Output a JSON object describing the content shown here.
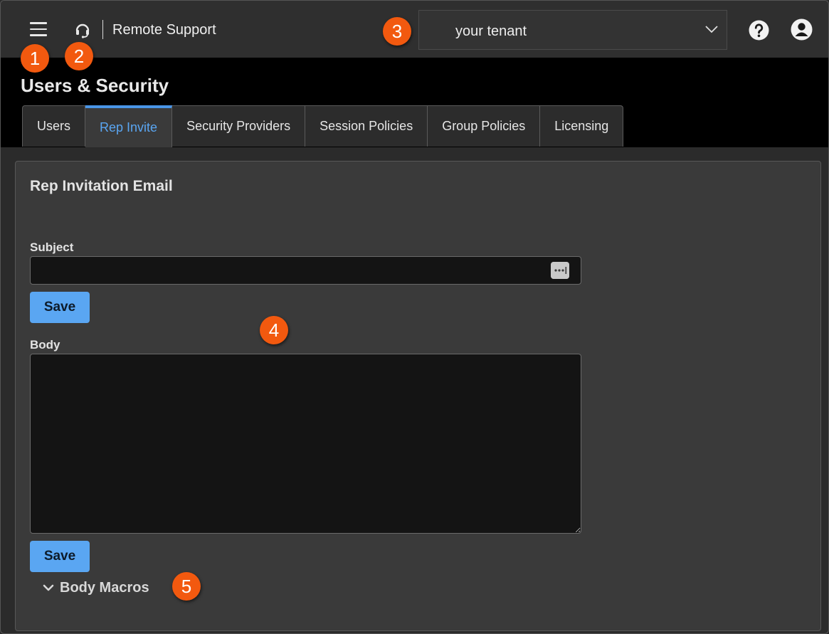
{
  "topbar": {
    "app_title": "Remote Support",
    "tenant_select": {
      "value": "your tenant"
    },
    "menu_icon": "hamburger-icon",
    "app_icon": "headset-icon",
    "help_icon": "help-icon",
    "user_icon": "user-account-icon"
  },
  "header": {
    "page_title": "Users & Security",
    "tabs": [
      {
        "label": "Users",
        "active": false
      },
      {
        "label": "Rep Invite",
        "active": true
      },
      {
        "label": "Security Providers",
        "active": false
      },
      {
        "label": "Session Policies",
        "active": false
      },
      {
        "label": "Group Policies",
        "active": false
      },
      {
        "label": "Licensing",
        "active": false
      }
    ]
  },
  "panel": {
    "title": "Rep Invitation Email",
    "subject_label": "Subject",
    "subject_value": "",
    "body_label": "Body",
    "body_value": "",
    "save_label": "Save",
    "macros_label": "Body Macros"
  },
  "callouts": [
    "1",
    "2",
    "3",
    "4",
    "5"
  ],
  "colors": {
    "accent": "#5aa6f2",
    "callout": "#f2590f",
    "header_bg": "#000000",
    "panel_bg": "#3a3a3a"
  }
}
